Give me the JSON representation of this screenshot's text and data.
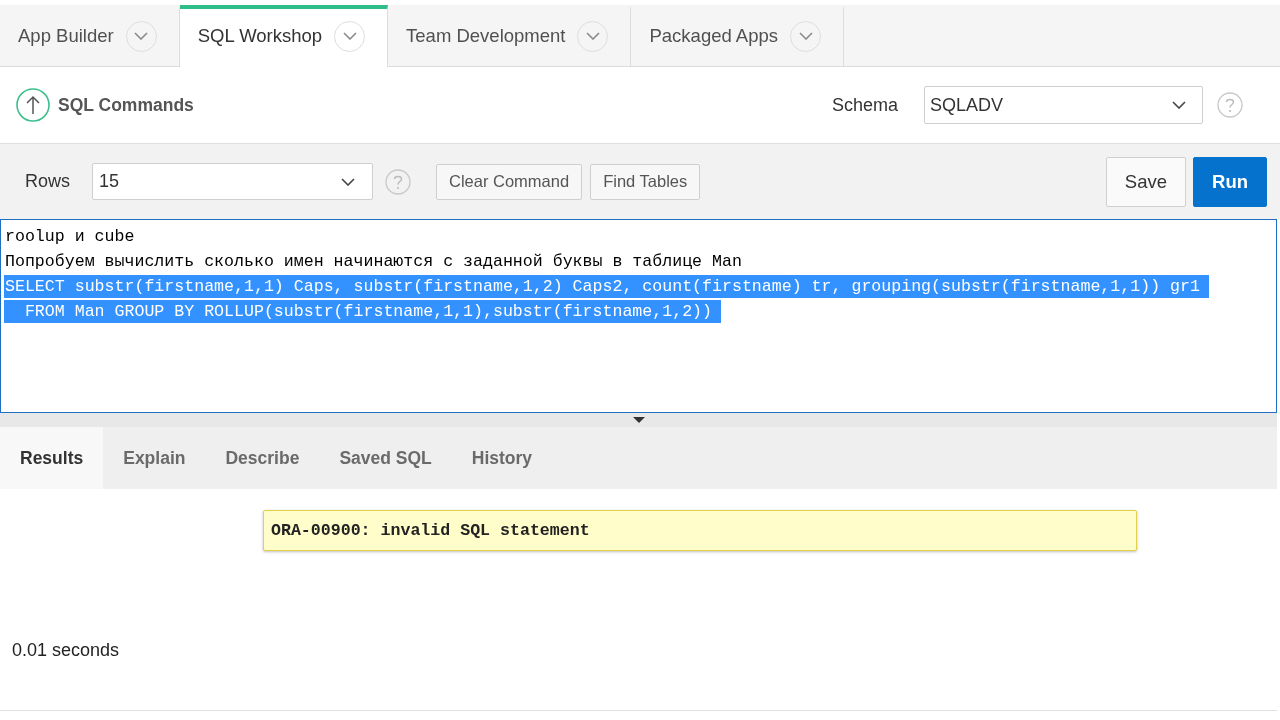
{
  "nav_tabs": [
    {
      "label": "App Builder",
      "selected": false
    },
    {
      "label": "SQL Workshop",
      "selected": true
    },
    {
      "label": "Team Development",
      "selected": false
    },
    {
      "label": "Packaged Apps",
      "selected": false
    }
  ],
  "header": {
    "title": "SQL Commands",
    "schema_label": "Schema",
    "schema_value": "SQLADV"
  },
  "toolbar": {
    "rows_label": "Rows",
    "rows_value": "15",
    "buttons": [
      {
        "label": "Clear Command",
        "kind": "secondary"
      },
      {
        "label": "Find Tables",
        "kind": "secondary"
      },
      {
        "label": "Save",
        "kind": "default"
      },
      {
        "label": "Run",
        "kind": "primary"
      }
    ]
  },
  "editor": {
    "lines": [
      {
        "text": "roolup и cube",
        "selected": false
      },
      {
        "text": "Попробуем вычислить сколько имен начинаются с заданной буквы в таблице Man",
        "selected": false
      },
      {
        "text": "SELECT substr(firstname,1,1) Caps, substr(firstname,1,2) Caps2, count(firstname) tr, grouping(substr(firstname,1,1)) gr1",
        "selected": true
      },
      {
        "text": "  FROM Man GROUP BY ROLLUP(substr(firstname,1,1),substr(firstname,1,2))",
        "selected": true
      }
    ]
  },
  "result_tabs": [
    {
      "label": "Results",
      "selected": true
    },
    {
      "label": "Explain",
      "selected": false
    },
    {
      "label": "Describe",
      "selected": false
    },
    {
      "label": "Saved SQL",
      "selected": false
    },
    {
      "label": "History",
      "selected": false
    }
  ],
  "results": {
    "message": "ORA-00900: invalid SQL statement",
    "elapsed": "0.01 seconds"
  }
}
